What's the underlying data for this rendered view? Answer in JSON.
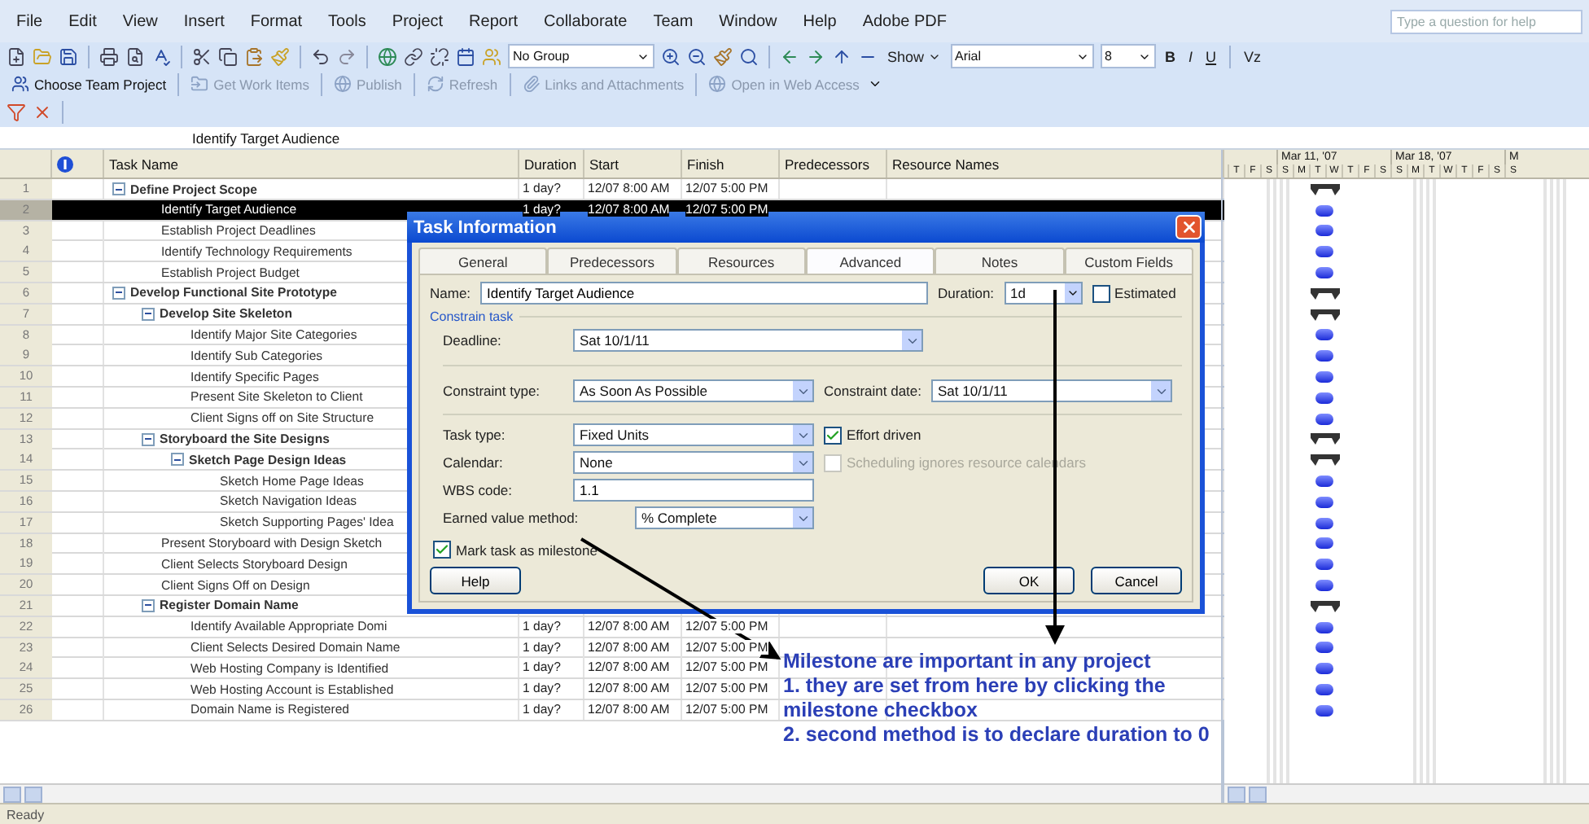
{
  "menu": [
    "File",
    "Edit",
    "View",
    "Insert",
    "Format",
    "Tools",
    "Project",
    "Report",
    "Collaborate",
    "Team",
    "Window",
    "Help",
    "Adobe PDF"
  ],
  "help_search": {
    "placeholder": "Type a question for help"
  },
  "toolbar": {
    "group": "No Group",
    "show": "Show",
    "font": "Arial",
    "font_size": "8",
    "bold": "B",
    "italic": "I",
    "underline": "U",
    "filter": "Vz"
  },
  "team_toolbar": [
    {
      "label": "Choose Team Project",
      "disabled": false
    },
    {
      "label": "Get Work Items",
      "disabled": true
    },
    {
      "label": "Publish",
      "disabled": true
    },
    {
      "label": "Refresh",
      "disabled": true
    },
    {
      "label": "Links and Attachments",
      "disabled": true
    },
    {
      "label": "Open in Web Access",
      "disabled": true
    }
  ],
  "entry_bar": "Identify Target Audience",
  "table": {
    "columns": [
      "Task Name",
      "Duration",
      "Start",
      "Finish",
      "Predecessors",
      "Resource Names"
    ],
    "rows": [
      {
        "id": "1",
        "name": "Define Project Scope",
        "kind": "summary",
        "expanded": true,
        "selected": false,
        "duration": "1 day?",
        "start": "12/07 8:00 AM",
        "finish": "12/07 5:00 PM",
        "children": [
          {
            "id": "2",
            "name": "Identify Target Audience",
            "kind": "task",
            "selected": true,
            "duration": "1 day?",
            "start": "12/07 8:00 AM",
            "finish": "12/07 5:00 PM"
          },
          {
            "id": "3",
            "name": "Establish Project Deadlines",
            "kind": "task",
            "selected": false
          },
          {
            "id": "4",
            "name": "Identify Technology Requirements",
            "kind": "task",
            "selected": false
          },
          {
            "id": "5",
            "name": "Establish Project Budget",
            "kind": "task",
            "selected": false
          }
        ]
      },
      {
        "id": "6",
        "name": "Develop Functional Site Prototype",
        "kind": "summary",
        "expanded": true,
        "selected": false,
        "children": [
          {
            "id": "7",
            "name": "Develop Site Skeleton",
            "kind": "summary",
            "expanded": true,
            "selected": false,
            "children": [
              {
                "id": "8",
                "name": "Identify Major Site Categories",
                "kind": "task",
                "selected": false
              },
              {
                "id": "9",
                "name": "Identify Sub Categories",
                "kind": "task",
                "selected": false
              },
              {
                "id": "10",
                "name": "Identify Specific Pages",
                "kind": "task",
                "selected": false
              },
              {
                "id": "11",
                "name": "Present Site Skeleton to Client",
                "kind": "task",
                "selected": false
              },
              {
                "id": "12",
                "name": "Client Signs off on Site Structure",
                "kind": "task",
                "selected": false
              }
            ]
          },
          {
            "id": "13",
            "name": "Storyboard the Site Designs",
            "kind": "summary",
            "expanded": true,
            "selected": false,
            "children": [
              {
                "id": "14",
                "name": "Sketch Page Design Ideas",
                "kind": "summary",
                "expanded": true,
                "selected": false,
                "children": [
                  {
                    "id": "15",
                    "name": "Sketch Home Page Ideas",
                    "kind": "task",
                    "selected": false
                  },
                  {
                    "id": "16",
                    "name": "Sketch Navigation Ideas",
                    "kind": "task",
                    "selected": false
                  },
                  {
                    "id": "17",
                    "name": "Sketch Supporting Pages' Idea",
                    "kind": "task",
                    "selected": false
                  }
                ]
              }
            ]
          },
          {
            "id": "18",
            "name": "Present Storyboard with Design Sketch",
            "kind": "task",
            "selected": false
          },
          {
            "id": "19",
            "name": "Client Selects Storyboard Design",
            "kind": "task",
            "selected": false
          },
          {
            "id": "20",
            "name": "Client Signs Off on Design",
            "kind": "task",
            "selected": false
          },
          {
            "id": "21",
            "name": "Register Domain Name",
            "kind": "summary",
            "expanded": true,
            "selected": false,
            "children": [
              {
                "id": "22",
                "name": "Identify Available Appropriate Domi",
                "kind": "task",
                "selected": false,
                "duration": "1 day?",
                "start": "12/07 8:00 AM",
                "finish": "12/07 5:00 PM"
              },
              {
                "id": "23",
                "name": "Client Selects Desired Domain Name",
                "kind": "task",
                "selected": false,
                "duration": "1 day?",
                "start": "12/07 8:00 AM",
                "finish": "12/07 5:00 PM"
              },
              {
                "id": "24",
                "name": "Web Hosting Company is Identified",
                "kind": "task",
                "selected": false,
                "duration": "1 day?",
                "start": "12/07 8:00 AM",
                "finish": "12/07 5:00 PM"
              },
              {
                "id": "25",
                "name": "Web Hosting Account is Established",
                "kind": "task",
                "selected": false,
                "duration": "1 day?",
                "start": "12/07 8:00 AM",
                "finish": "12/07 5:00 PM"
              },
              {
                "id": "26",
                "name": "Domain Name is Registered",
                "kind": "task",
                "selected": false,
                "duration": "1 day?",
                "start": "12/07 8:00 AM",
                "finish": "12/07 5:00 PM"
              }
            ]
          }
        ]
      }
    ]
  },
  "gantt": {
    "weeks": [
      "Mar 11, '07",
      "Mar 18, '07",
      "M"
    ],
    "days": [
      "T",
      "F",
      "S",
      "S",
      "M",
      "T",
      "W",
      "T",
      "F",
      "S",
      "S",
      "M",
      "T",
      "W",
      "T",
      "F",
      "S",
      "S"
    ]
  },
  "dialog": {
    "title": "Task Information",
    "tabs": [
      {
        "label": "General",
        "selected": false
      },
      {
        "label": "Predecessors",
        "selected": false
      },
      {
        "label": "Resources",
        "selected": false
      },
      {
        "label": "Advanced",
        "selected": true
      },
      {
        "label": "Notes",
        "selected": false
      },
      {
        "label": "Custom Fields",
        "selected": false
      }
    ],
    "name_label": "Name:",
    "name": "Identify Target Audience",
    "duration_label": "Duration:",
    "duration": "1d",
    "estimated": {
      "label": "Estimated",
      "checked": false
    },
    "group": "Constrain task",
    "deadline_label": "Deadline:",
    "deadline": "Sat 10/1/11",
    "constraint_type_label": "Constraint type:",
    "constraint_type": "As Soon As Possible",
    "constraint_date_label": "Constraint date:",
    "constraint_date": "Sat 10/1/11",
    "task_type_label": "Task type:",
    "task_type": "Fixed Units",
    "effort_driven": {
      "label": "Effort driven",
      "checked": true
    },
    "calendar_label": "Calendar:",
    "calendar": "None",
    "ignore_calendars": {
      "label": "Scheduling ignores resource calendars",
      "checked": false,
      "disabled": true
    },
    "wbs_label": "WBS code:",
    "wbs": "1.1",
    "earned_value_label": "Earned value method:",
    "earned_value": "% Complete",
    "milestone": {
      "label": "Mark task as milestone",
      "checked": true
    },
    "buttons": [
      "Help",
      "OK",
      "Cancel"
    ]
  },
  "annotation": [
    "Milestone are important in any project",
    "1. they are set from here by clicking the",
    "milestone checkbox",
    "2. second method is to declare duration to 0"
  ],
  "status_bar": "Ready"
}
